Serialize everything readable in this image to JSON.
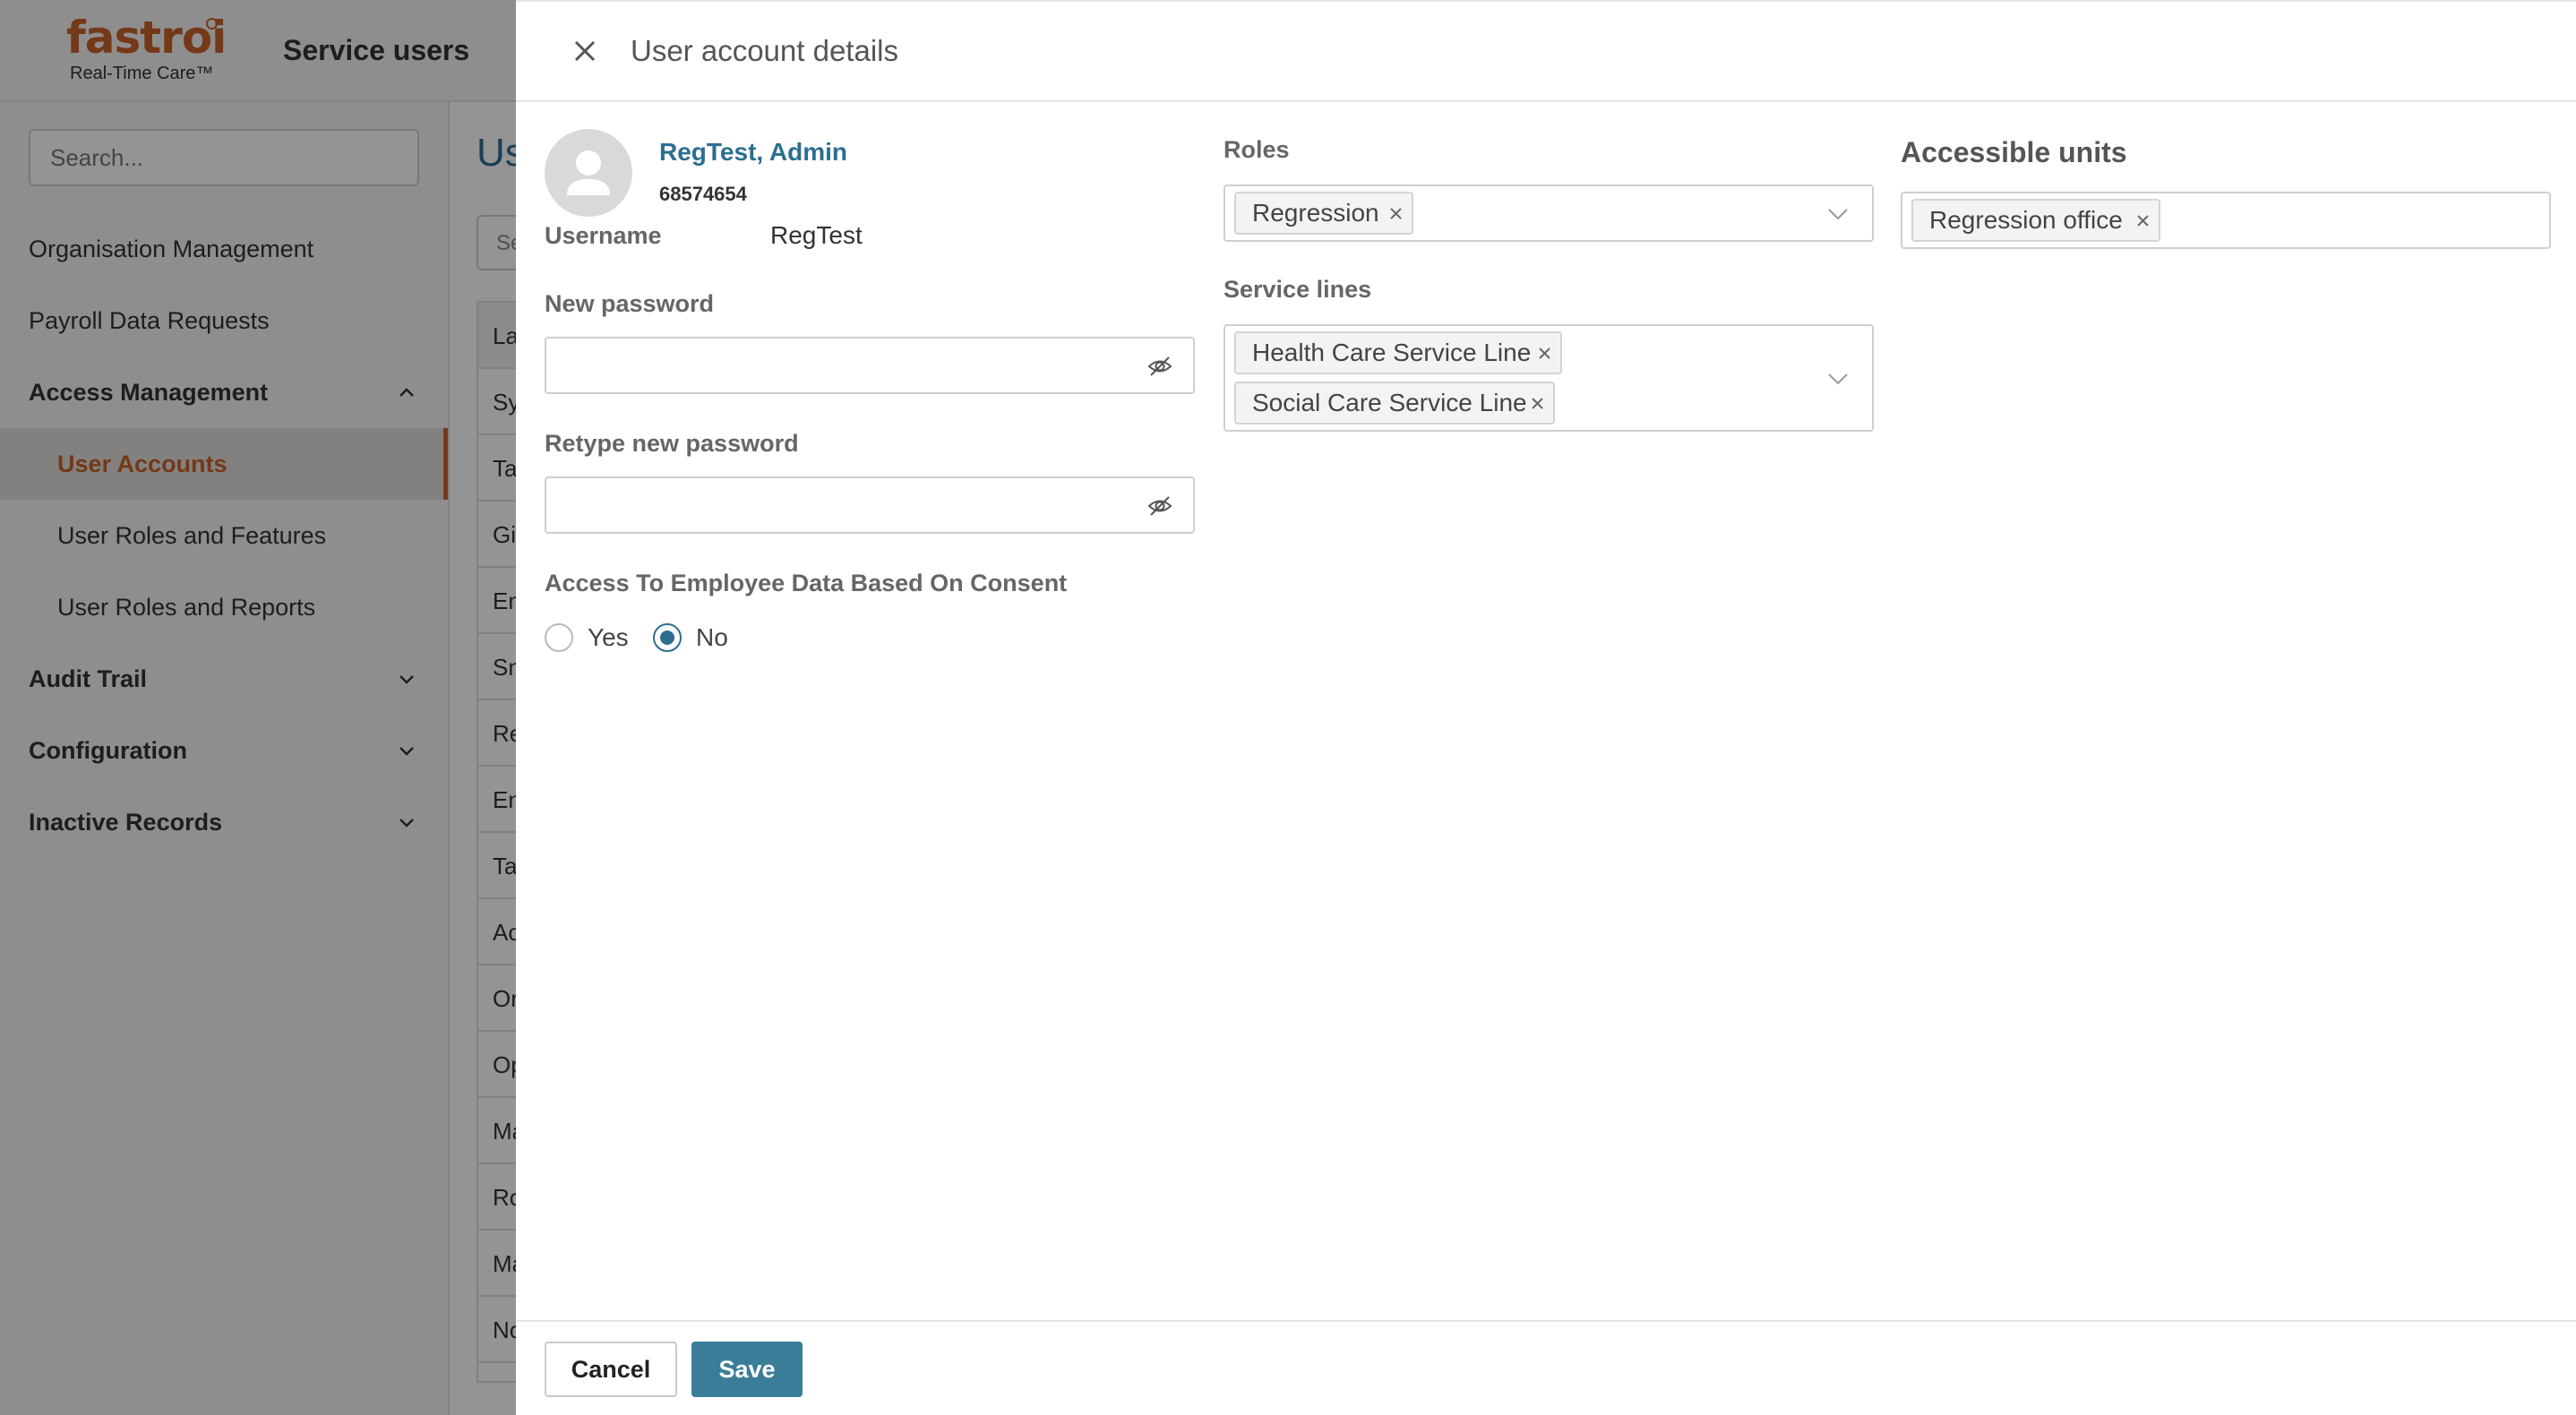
{
  "app": {
    "logo_text": "fastroi",
    "logo_sub": "Real-Time Care™",
    "header_title": "Service users"
  },
  "sidebar": {
    "search_placeholder": "Search...",
    "items": [
      {
        "label": "Organisation Management"
      },
      {
        "label": "Payroll Data Requests"
      },
      {
        "label": "Access Management"
      },
      {
        "label": "User Accounts"
      },
      {
        "label": "User Roles and Features"
      },
      {
        "label": "User Roles and Reports"
      },
      {
        "label": "Audit Trail"
      },
      {
        "label": "Configuration"
      },
      {
        "label": "Inactive Records"
      }
    ]
  },
  "background": {
    "page_title_fragment": "Us",
    "search_fragment": "Se",
    "table_fragments": [
      "La",
      "Sy",
      "Ta",
      "Gi",
      "En",
      "Sn",
      "Re",
      "En",
      "Ta",
      "Ac",
      "Or",
      "Op",
      "Ma",
      "Ro",
      "Ma",
      "No"
    ]
  },
  "panel": {
    "title": "User account details",
    "user": {
      "display_name": "RegTest, Admin",
      "id": "68574654",
      "username_label": "Username",
      "username_value": "RegTest"
    },
    "new_password": {
      "label": "New password",
      "value": ""
    },
    "retype_password": {
      "label": "Retype new password",
      "value": ""
    },
    "consent": {
      "label": "Access To Employee Data Based On Consent",
      "yes_label": "Yes",
      "no_label": "No",
      "selected": "No"
    },
    "roles": {
      "label": "Roles",
      "tags": [
        "Regression"
      ]
    },
    "service_lines": {
      "label": "Service lines",
      "tags": [
        "Health Care Service Line",
        "Social Care Service Line"
      ]
    },
    "accessible_units": {
      "label": "Accessible units",
      "tags": [
        "Regression office"
      ]
    },
    "cancel_label": "Cancel",
    "save_label": "Save"
  },
  "colors": {
    "brand_orange": "#c9622a",
    "accent_blue": "#2c6e8f",
    "save_button": "#3a7d98"
  }
}
